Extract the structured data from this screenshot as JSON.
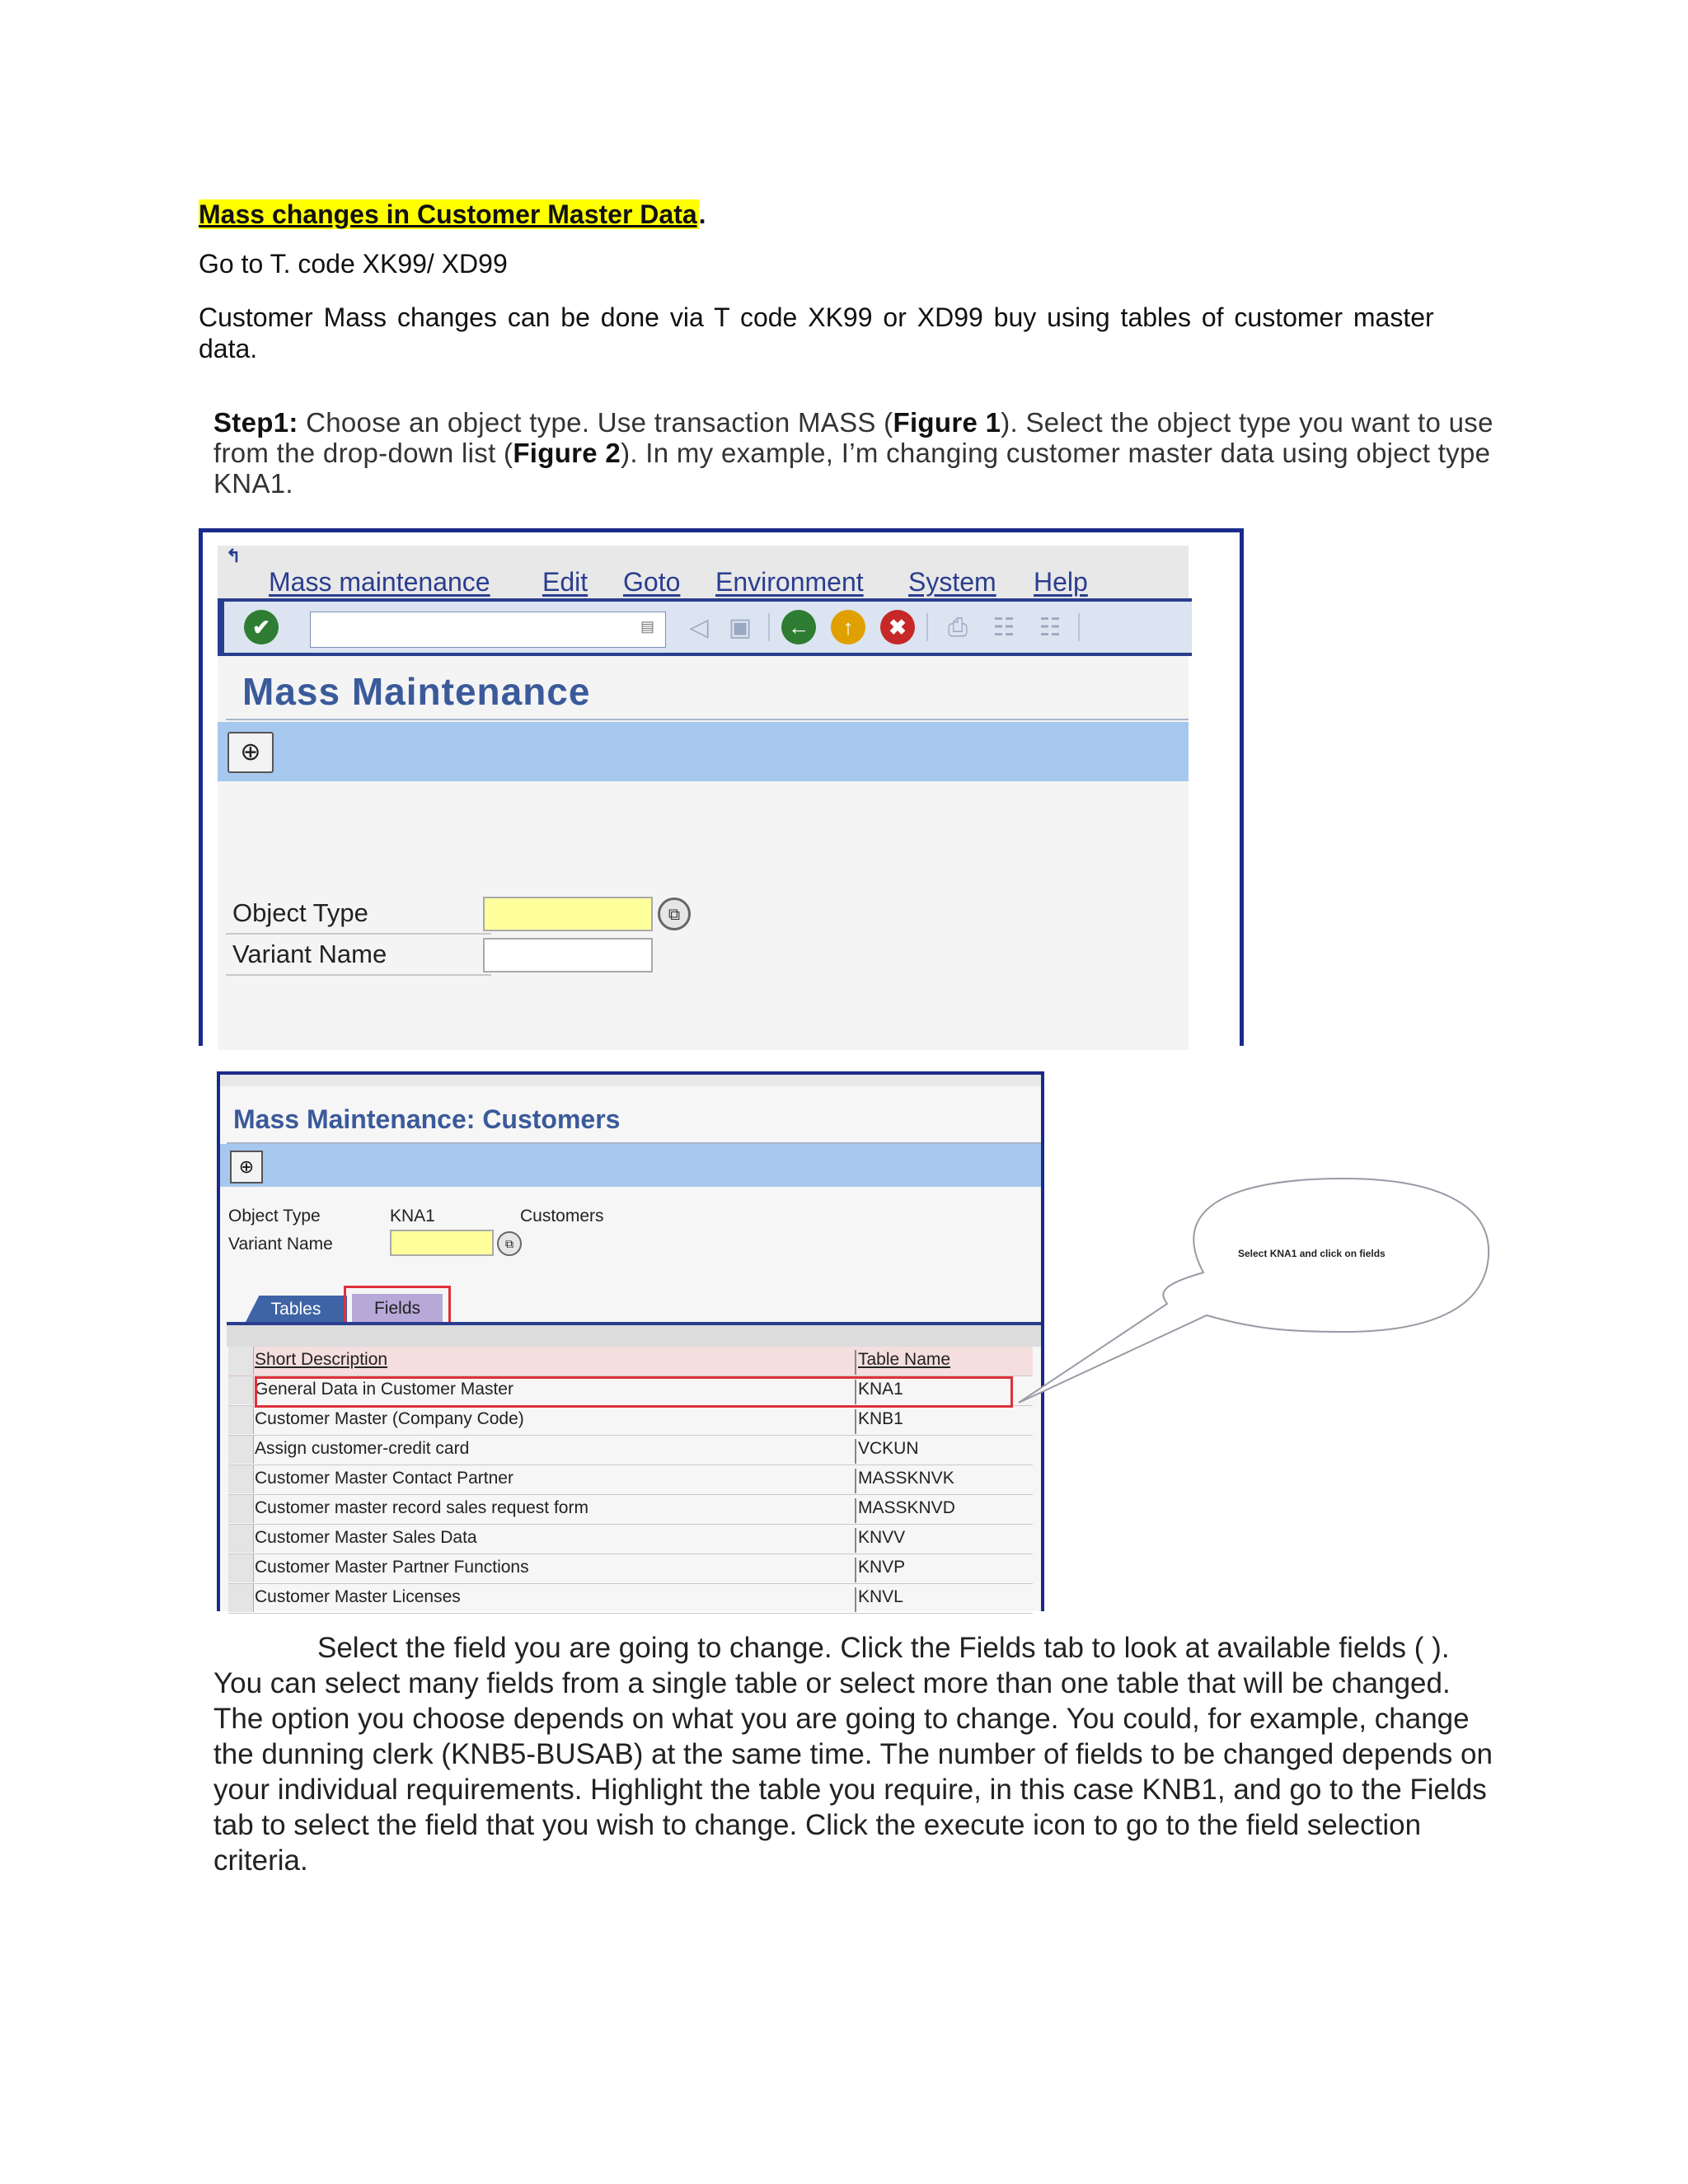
{
  "doc": {
    "title": "Mass changes in Customer Master Data",
    "title_suffix": ".",
    "line1": "Go to T. code XK99/ XD99",
    "para1": "Customer Mass changes can be done via T code XK99 or XD99 buy using tables of customer master data.",
    "step_label": "Step1:",
    "step_text_1": " Choose an object type. Use transaction MASS (",
    "step_fig1": "Figure 1",
    "step_text_2": "). Select the object type you want to use from the drop-down list (",
    "step_fig2": "Figure 2",
    "step_text_3": "). In my example, I’m changing customer master data using object type KNA1.",
    "bottom_para": "Select the field you are going to change. Click the Fields tab to look at available fields ( ). You can select many fields from a single table or select more than one table that will be changed. The option you choose depends on what you are going to change. You could, for example, change the dunning clerk (KNB5-BUSAB) at the same time. The number of fields to be changed depends on your individual requirements. Highlight the table you require, in this case KNB1, and go to the Fields tab to select the field that you wish to change. Click the execute icon to go to the field selection criteria."
  },
  "shot1": {
    "menu": [
      "Mass maintenance",
      "Edit",
      "Goto",
      "Environment",
      "System",
      "Help"
    ],
    "title": "Mass Maintenance",
    "object_type_label": "Object Type",
    "variant_name_label": "Variant Name",
    "object_type_value": "",
    "variant_name_value": ""
  },
  "shot2": {
    "title": "Mass Maintenance: Customers",
    "object_type_label": "Object Type",
    "object_type_value": "KNA1",
    "object_type_desc": "Customers",
    "variant_name_label": "Variant Name",
    "variant_name_value": "",
    "tabs": [
      "Tables",
      "Fields"
    ],
    "columns": [
      "Short Description",
      "Table Name"
    ],
    "rows": [
      {
        "desc": "General Data in Customer Master",
        "name": "KNA1"
      },
      {
        "desc": "Customer Master (Company Code)",
        "name": "KNB1"
      },
      {
        "desc": "Assign customer-credit card",
        "name": "VCKUN"
      },
      {
        "desc": "Customer Master Contact Partner",
        "name": "MASSKNVK"
      },
      {
        "desc": "Customer master record sales request form",
        "name": "MASSKNVD"
      },
      {
        "desc": "Customer Master Sales Data",
        "name": "KNVV"
      },
      {
        "desc": "Customer Master Partner Functions",
        "name": "KNVP"
      },
      {
        "desc": "Customer Master Licenses",
        "name": "KNVL"
      }
    ]
  },
  "callout": {
    "text": "Select KNA1 and click on fields"
  },
  "icons": {
    "enter": "check-icon",
    "back": "back-icon",
    "exit": "exit-icon",
    "cancel": "cancel-icon",
    "execute": "execute-icon"
  },
  "colors": {
    "highlight": "#ffff00",
    "sap_blue": "#2a3d8f",
    "appbar": "#a7c8ee",
    "input_required": "#ffff9c",
    "red_box": "#e0303a"
  }
}
